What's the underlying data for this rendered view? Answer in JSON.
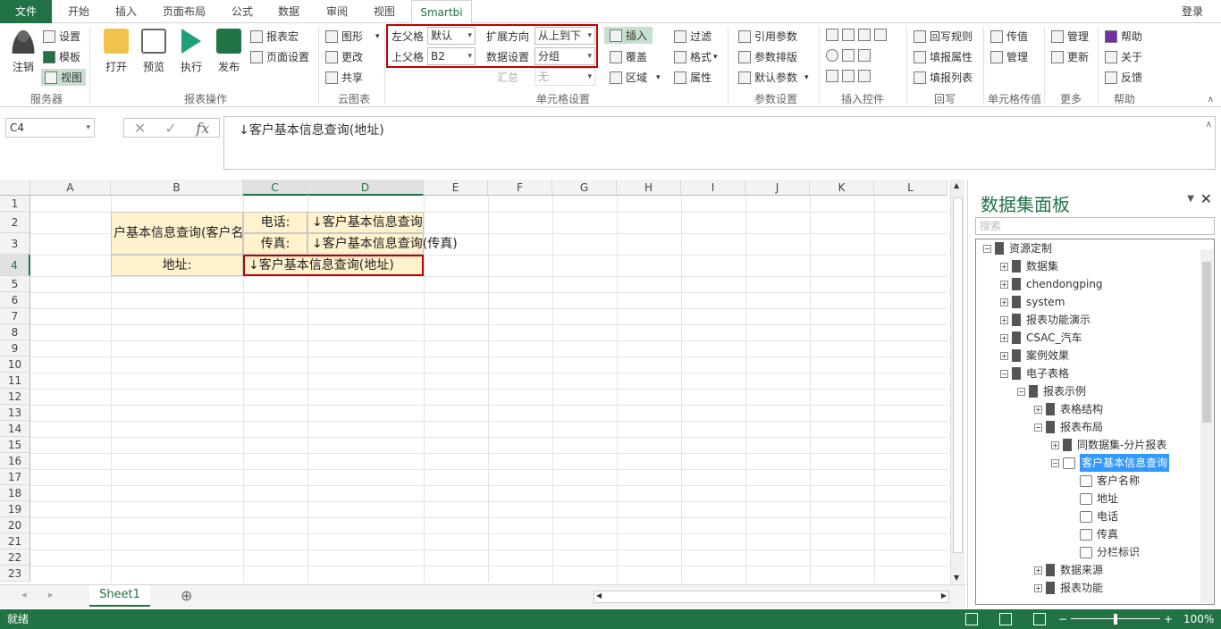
{
  "tabs": {
    "file": "文件",
    "start": "开始",
    "insert": "插入",
    "page_layout": "页面布局",
    "formula": "公式",
    "data": "数据",
    "review": "审阅",
    "view": "视图",
    "smartbi": "Smartbi",
    "login": "登录"
  },
  "ribbon": {
    "logout": "注销",
    "settings": "设置",
    "template": "模板",
    "view": "视图",
    "open": "打开",
    "preview": "预览",
    "execute": "执行",
    "publish": "发布",
    "report_macro": "报表宏",
    "page_settings": "页面设置",
    "chart": "图形",
    "update": "更改",
    "share": "共享",
    "left_parent": "左父格",
    "left_parent_val": "默认",
    "top_parent": "上父格",
    "top_parent_val": "B2",
    "expand_dir": "扩展方向",
    "expand_dir_val": "从上到下",
    "data_settings": "数据设置",
    "data_settings_val": "分组",
    "summary": "汇总",
    "summary_val": "无",
    "insert": "插入",
    "overwrite": "覆盖",
    "region": "区域",
    "filter": "过滤",
    "format": "格式",
    "property": "属性",
    "ref_param": "引用参数",
    "param_layout": "参数排版",
    "default_param": "默认参数",
    "writeback_rule": "回写规则",
    "fill_property": "填报属性",
    "fill_list": "填报列表",
    "pass_value": "传值",
    "manage_cell": "管理",
    "manage": "管理",
    "refresh": "更新",
    "help": "帮助",
    "about": "关于",
    "feedback": "反馈",
    "groups": {
      "service": "服务器",
      "report_ops": "报表操作",
      "cloud_chart": "云图表",
      "cell_settings": "单元格设置",
      "param_settings": "参数设置",
      "insert_ctrl": "插入控件",
      "writeback": "回写",
      "cell_pass": "单元格传值",
      "more": "更多",
      "help": "帮助"
    }
  },
  "formula": {
    "namebox": "C4",
    "content": "↓客户基本信息查询(地址)"
  },
  "columns": [
    "A",
    "B",
    "C",
    "D",
    "E",
    "F",
    "G",
    "H",
    "I",
    "J",
    "K",
    "L"
  ],
  "rows": [
    "1",
    "2",
    "3",
    "4",
    "5",
    "6",
    "7",
    "8",
    "9",
    "10",
    "11",
    "12",
    "13",
    "14",
    "15",
    "16",
    "17",
    "18",
    "19",
    "20",
    "21",
    "22",
    "23"
  ],
  "cells": {
    "b2": "户基本信息查询(客户名",
    "c2": "电话:",
    "d2": "↓客户基本信息查询",
    "c3": "传真:",
    "d3": "↓客户基本信息查询(传真)",
    "b4": "地址:",
    "c4": "↓客户基本信息查询(地址)"
  },
  "sheet": {
    "name": "Sheet1",
    "add": "⊕"
  },
  "status": {
    "ready": "就绪",
    "zoom": "100%"
  },
  "panel": {
    "title": "数据集面板",
    "search_placeholder": "搜索",
    "tree": [
      {
        "label": "资源定制",
        "level": 0,
        "pm": "⊟"
      },
      {
        "label": "数据集",
        "level": 1,
        "pm": "⊞"
      },
      {
        "label": "chendongping",
        "level": 1,
        "pm": "⊞"
      },
      {
        "label": "system",
        "level": 1,
        "pm": "⊞"
      },
      {
        "label": "报表功能演示",
        "level": 1,
        "pm": "⊞"
      },
      {
        "label": "CSAC_汽车",
        "level": 1,
        "pm": "⊞"
      },
      {
        "label": "案例效果",
        "level": 1,
        "pm": "⊞"
      },
      {
        "label": "电子表格",
        "level": 1,
        "pm": "⊟"
      },
      {
        "label": "报表示例",
        "level": 2,
        "pm": "⊟"
      },
      {
        "label": "表格结构",
        "level": 3,
        "pm": "⊞"
      },
      {
        "label": "报表布局",
        "level": 3,
        "pm": "⊟"
      },
      {
        "label": "同数据集-分片报表",
        "level": 4,
        "pm": "⊞"
      },
      {
        "label": "客户基本信息查询",
        "level": 4,
        "pm": "⊟",
        "hl": true
      },
      {
        "label": "客户名称",
        "level": 5,
        "pm": ""
      },
      {
        "label": "地址",
        "level": 5,
        "pm": ""
      },
      {
        "label": "电话",
        "level": 5,
        "pm": ""
      },
      {
        "label": "传真",
        "level": 5,
        "pm": ""
      },
      {
        "label": "分栏标识",
        "level": 5,
        "pm": ""
      },
      {
        "label": "数据来源",
        "level": 3,
        "pm": "⊞"
      },
      {
        "label": "报表功能",
        "level": 3,
        "pm": "⊞"
      }
    ]
  }
}
